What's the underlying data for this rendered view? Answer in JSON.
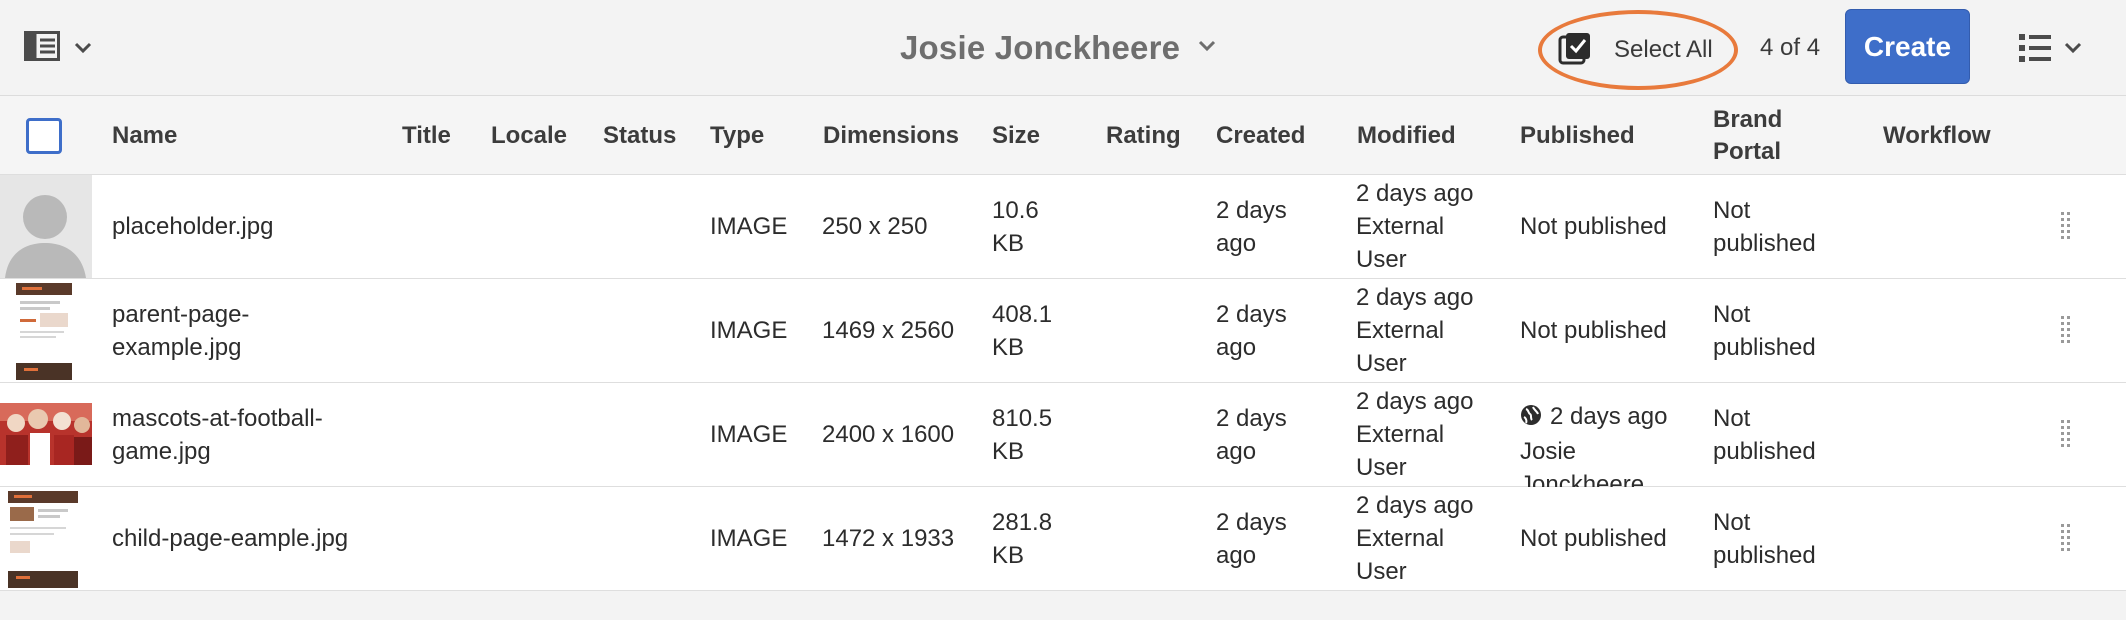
{
  "toolbar": {
    "owner_name": "Josie Jonckheere",
    "select_all_label": "Select All",
    "selection_count": "4 of 4",
    "create_label": "Create",
    "accent_color": "#3e6ec9",
    "highlight_color": "#e87a3c"
  },
  "columns": {
    "name": "Name",
    "title": "Title",
    "locale": "Locale",
    "status": "Status",
    "type": "Type",
    "dimensions": "Dimensions",
    "size": "Size",
    "rating": "Rating",
    "created": "Created",
    "modified": "Modified",
    "published": "Published",
    "brand_portal": "Brand\nPortal",
    "workflow": "Workflow"
  },
  "rows": [
    {
      "thumb": "placeholder-avatar",
      "name": "placeholder.jpg",
      "type": "IMAGE",
      "dimensions": "250 x 250",
      "size": "10.6\nKB",
      "created": "2 days\nago",
      "modified": "2 days ago\nExternal\nUser",
      "published": "Not published",
      "brand_portal": "Not\npublished"
    },
    {
      "thumb": "webpage-screenshot",
      "name": "parent-page-\nexample.jpg",
      "type": "IMAGE",
      "dimensions": "1469 x 2560",
      "size": "408.1\nKB",
      "created": "2 days\nago",
      "modified": "2 days ago\nExternal\nUser",
      "published": "Not published",
      "brand_portal": "Not\npublished"
    },
    {
      "thumb": "mascots-photo",
      "name": "mascots-at-football-\ngame.jpg",
      "type": "IMAGE",
      "dimensions": "2400 x 1600",
      "size": "810.5\nKB",
      "created": "2 days\nago",
      "modified": "2 days ago\nExternal\nUser",
      "published_date": "2 days ago",
      "published_by": "Josie\nJonckheere",
      "brand_portal": "Not\npublished"
    },
    {
      "thumb": "webpage-screenshot",
      "name": "child-page-eample.jpg",
      "type": "IMAGE",
      "dimensions": "1472 x 1933",
      "size": "281.8\nKB",
      "created": "2 days\nago",
      "modified": "2 days ago\nExternal\nUser",
      "published": "Not published",
      "brand_portal": "Not\npublished"
    }
  ]
}
